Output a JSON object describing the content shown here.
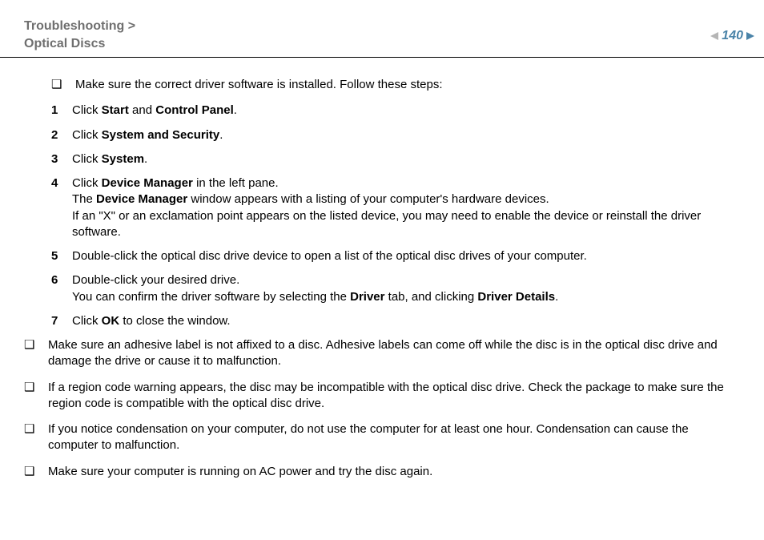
{
  "header": {
    "breadcrumb1": "Troubleshooting",
    "breadcrumb2": "Optical Discs",
    "page": "140"
  },
  "content": {
    "bullet_driver_intro": "Make sure the correct driver software is installed. Follow these steps:",
    "steps": {
      "s1_pre": "Click ",
      "s1_b1": "Start",
      "s1_mid": " and ",
      "s1_b2": "Control Panel",
      "s1_post": ".",
      "s2_pre": "Click ",
      "s2_b1": "System and Security",
      "s2_post": ".",
      "s3_pre": "Click ",
      "s3_b1": "System",
      "s3_post": ".",
      "s4_pre": "Click ",
      "s4_b1": "Device Manager",
      "s4_post": " in the left pane.",
      "s4_l2a": "The ",
      "s4_l2b": "Device Manager",
      "s4_l2c": " window appears with a listing of your computer's hardware devices.",
      "s4_l3": "If an \"X\" or an exclamation point appears on the listed device, you may need to enable the device or reinstall the driver software.",
      "s5": "Double-click the optical disc drive device to open a list of the optical disc drives of your computer.",
      "s6_l1": "Double-click your desired drive.",
      "s6_l2a": "You can confirm the driver software by selecting the ",
      "s6_l2b": "Driver",
      "s6_l2c": " tab, and clicking ",
      "s6_l2d": "Driver Details",
      "s6_l2e": ".",
      "s7_pre": "Click ",
      "s7_b1": "OK",
      "s7_post": " to close the window."
    },
    "bullet_label": "Make sure an adhesive label is not affixed to a disc. Adhesive labels can come off while the disc is in the optical disc drive and damage the drive or cause it to malfunction.",
    "bullet_region": "If a region code warning appears, the disc may be incompatible with the optical disc drive. Check the package to make sure the region code is compatible with the optical disc drive.",
    "bullet_condensation": "If you notice condensation on your computer, do not use the computer for at least one hour. Condensation can cause the computer to malfunction.",
    "bullet_ac": "Make sure your computer is running on AC power and try the disc again."
  }
}
